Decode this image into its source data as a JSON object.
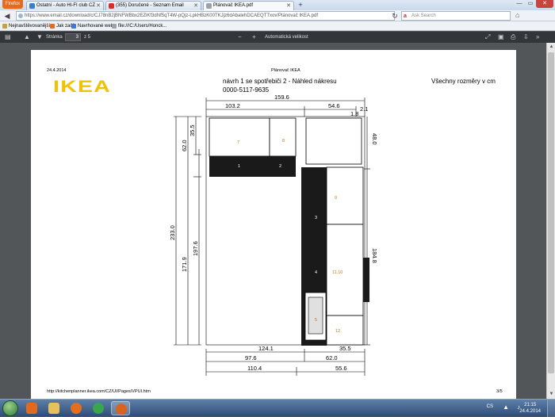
{
  "browser": {
    "menu_label": "Firefox",
    "tabs": [
      {
        "label": "Ostatní - Auto HI-FI club CZ",
        "icon_color": "#3d7bd1"
      },
      {
        "label": "(355) Doručené - Seznam Email",
        "icon_color": "#d12f2f"
      },
      {
        "label": "Plánovač IKEA.pdf",
        "icon_color": "#9aa3ad"
      }
    ],
    "active_tab": 2,
    "url": "https://www.email.cz/download/c/CJ78nB2jBNFWBbx2EZiKf3dNf5qT4W-pQjz-LpkHBzK00TKJjz6dAbalehDCAEQTTxov/Plánovač IKEA.pdf",
    "url_domain": "email.cz",
    "search_placeholder": "Ask Search",
    "bookmarks": [
      {
        "label": "Nejnavštěvovanější",
        "icon_color": "#c8a13a"
      },
      {
        "label": "Jak začít",
        "icon_color": "#e56b1e"
      },
      {
        "label": "Navrhované weby",
        "icon_color": "#3d7bd1"
      },
      {
        "label": "file:///C:/Users/Honck...",
        "icon_color": "#9aa3ad"
      }
    ]
  },
  "pdf_toolbar": {
    "page_label": "Stránka",
    "page_value": "3",
    "page_total": "z 5",
    "zoom_label": "Automatická velikost"
  },
  "document": {
    "date": "24.4.2014",
    "header_title": "Plánovač IKEA",
    "subtitle_line1": "návrh 1 se spotřebiči 2 - Náhled nákresu",
    "subtitle_line2": "0000-5117-9635",
    "units_note": "Všechny rozměry v cm",
    "logo_text": "IKEA",
    "footer_url": "http://kitchenplanner.ikea.com/CZ/UI/Pages/VPUI.htm",
    "footer_page": "3/5",
    "dimensions": {
      "top_total": "159.6",
      "top_left": "103.2",
      "top_right": "54.6",
      "top_small": "1.8",
      "top_small2": "2.1",
      "left_upper_h": "35.5",
      "left_upper_total": "62.0",
      "left_total": "233.0",
      "left_inner": "197.6",
      "left_lower": "171.9",
      "right_upper": "48.0",
      "right_lower": "184.8",
      "bottom_row1_left": "124.1",
      "bottom_row1_right": "35.5",
      "bottom_row2_left": "97.6",
      "bottom_row2_right": "62.0",
      "bottom_row3_left": "110.4",
      "bottom_row3_right": "55.6"
    },
    "item_numbers": [
      "1",
      "2",
      "3",
      "4",
      "5",
      "7",
      "8",
      "9",
      "11,10",
      "12"
    ]
  },
  "taskbar": {
    "clock_time": "21:15",
    "clock_date": "24.4.2014",
    "language": "CS",
    "apps": [
      {
        "name": "media-player",
        "color": "#e26a1e"
      },
      {
        "name": "explorer",
        "color": "#e7c25a"
      },
      {
        "name": "firefox",
        "color": "#e0701f"
      },
      {
        "name": "chrome",
        "color": "#3aa64a"
      },
      {
        "name": "firefox-active",
        "color": "#d9641b"
      }
    ]
  }
}
